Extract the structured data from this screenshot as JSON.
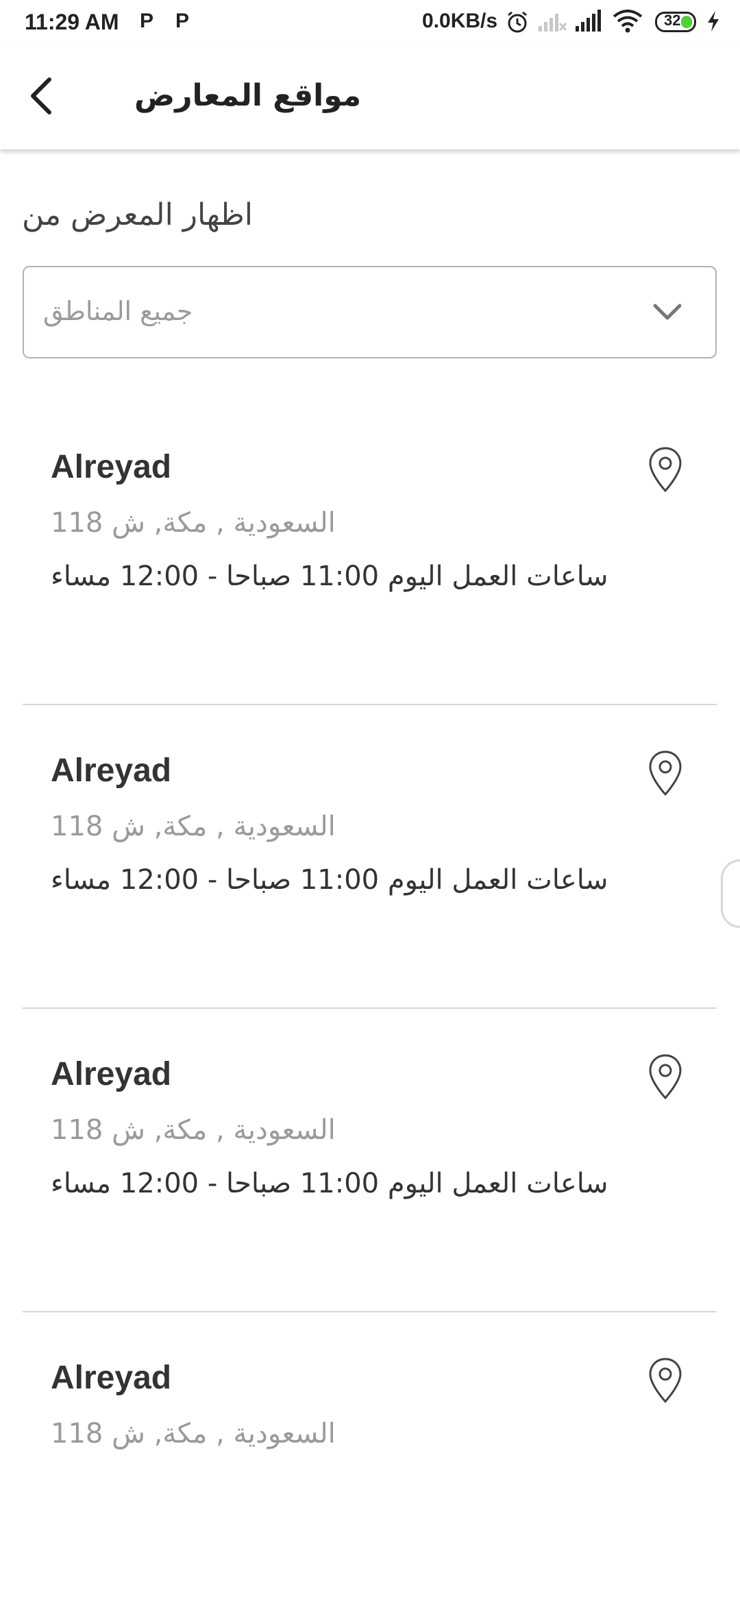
{
  "status_bar": {
    "time": "11:29 AM",
    "notif_1": "P",
    "notif_2": "P",
    "network_speed": "0.0KB/s",
    "battery_level": "32",
    "battery_color": "#4cd137",
    "icons": [
      "alarm-icon",
      "signal-off-icon",
      "signal-icon",
      "wifi-icon",
      "battery-icon",
      "charging-icon"
    ]
  },
  "app_bar": {
    "title": "مواقع المعارض",
    "back_icon": "chevron-left-icon"
  },
  "filter": {
    "label": "اظهار المعرض من",
    "selected_value": "جميع المناطق",
    "icon": "chevron-down-icon"
  },
  "locations": [
    {
      "name": "Alreyad",
      "address": "السعودية , مكة, ش 118",
      "hours": "ساعات العمل اليوم 11:00 صباحا - 12:00 مساء"
    },
    {
      "name": "Alreyad",
      "address": "السعودية , مكة, ش 118",
      "hours": "ساعات العمل اليوم 11:00 صباحا - 12:00 مساء"
    },
    {
      "name": "Alreyad",
      "address": "السعودية , مكة, ش 118",
      "hours": "ساعات العمل اليوم 11:00 صباحا - 12:00 مساء"
    },
    {
      "name": "Alreyad",
      "address": "السعودية , مكة, ش 118"
    }
  ]
}
